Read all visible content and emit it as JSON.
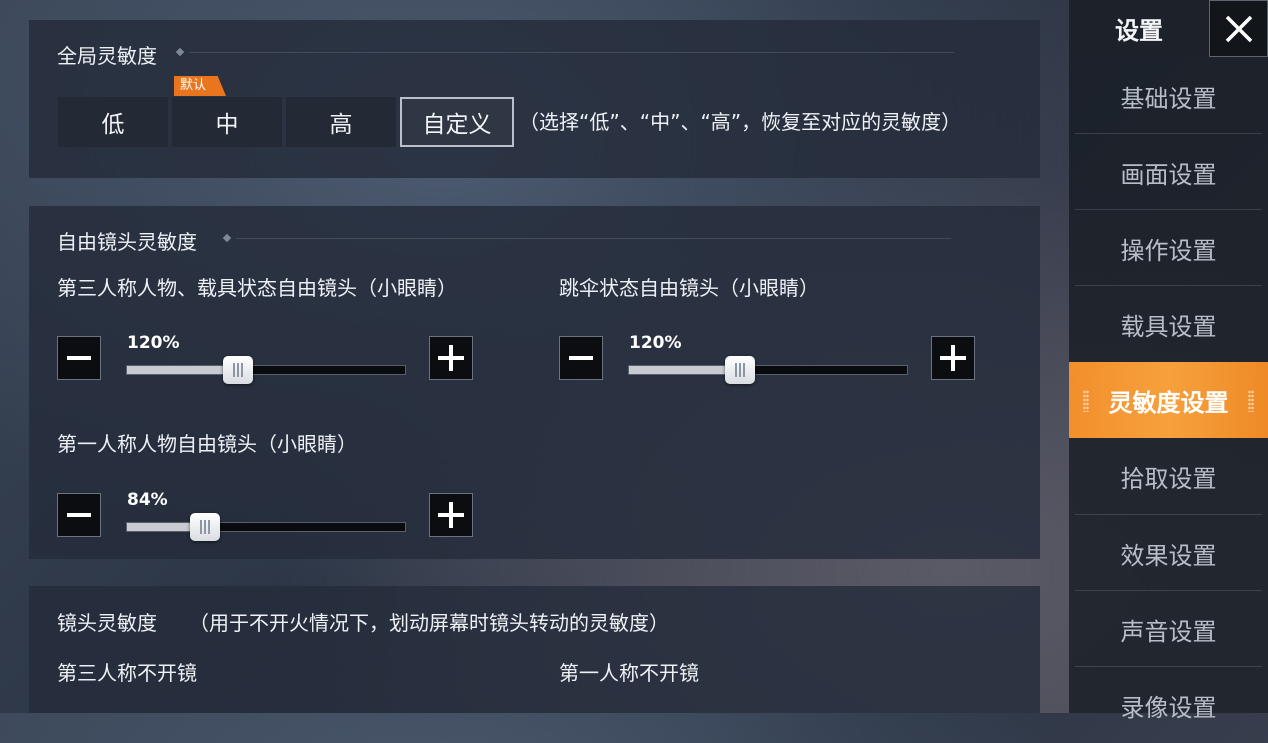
{
  "global": {
    "title": "全局灵敏度",
    "default_tag": "默认",
    "buttons": [
      "低",
      "中",
      "高",
      "自定义"
    ],
    "selected": "自定义",
    "hint": "（选择“低”、“中”、“高”，恢复至对应的灵敏度）"
  },
  "free_camera": {
    "title": "自由镜头灵敏度",
    "sliders": [
      {
        "label": "第三人称人物、载具状态自由镜头（小眼睛）",
        "value": "120%",
        "fraction": 0.4
      },
      {
        "label": "跳伞状态自由镜头（小眼睛）",
        "value": "120%",
        "fraction": 0.4
      },
      {
        "label": "第一人称人物自由镜头（小眼睛）",
        "value": "84%",
        "fraction": 0.28
      }
    ]
  },
  "camera": {
    "title": "镜头灵敏度",
    "hint": "（用于不开火情况下，划动屏幕时镜头转动的灵敏度）",
    "col1": "第三人称不开镜",
    "col2": "第一人称不开镜"
  },
  "sidebar": {
    "header": "设置",
    "items": [
      "基础设置",
      "画面设置",
      "操作设置",
      "载具设置",
      "灵敏度设置",
      "拾取设置",
      "效果设置",
      "声音设置",
      "录像设置"
    ],
    "active": "灵敏度设置"
  },
  "colors": {
    "accent": "#f29a35",
    "tag": "#e9761e"
  },
  "icons": {
    "close": "close-icon",
    "minus": "minus-icon",
    "plus": "plus-icon"
  }
}
